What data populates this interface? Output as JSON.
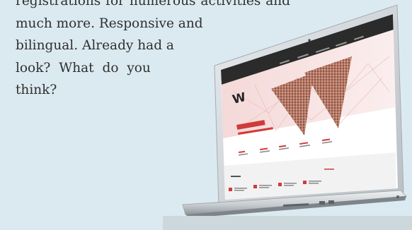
{
  "blurb": {
    "lines": [
      "registrations for numerous activities and",
      "much more. Responsive and",
      "bilingual. Already had a",
      "look? What do you",
      "think?"
    ]
  },
  "colors": {
    "background": "#dbeaf0",
    "accent": "#d13a3a",
    "screen_top_bar": "#2a2a2a",
    "laptop_body": "#c9ced2"
  },
  "website": {
    "logo": "W"
  }
}
